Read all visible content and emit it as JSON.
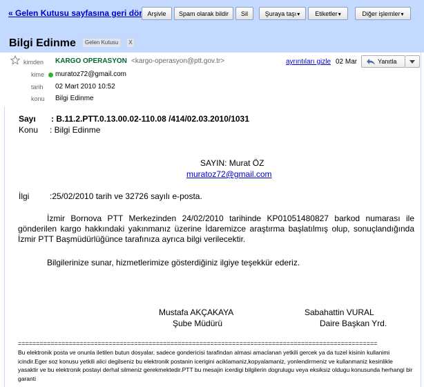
{
  "toolbar": {
    "back_link": "« Gelen Kutusu sayfasına geri dön",
    "archive": "Arşivle",
    "spam": "Spam olarak bildir",
    "delete": "Sil",
    "move_to": "Şuraya taşı",
    "labels": "Etiketler",
    "more_actions": "Diğer işlemler",
    "caret": "▾"
  },
  "message": {
    "subject": "Bilgi Edinme",
    "label_chip": "Gelen Kutusu",
    "label_remove": "X",
    "from_label": "kimden",
    "from_name": "KARGO OPERASYON",
    "from_email": "<kargo-operasyon@ptt.gov.tr>",
    "details_link": "ayrıntıları gizle",
    "date_short": "02 Mar",
    "reply": "Yanıtla",
    "to_label": "kime",
    "to_value": "muratoz72@gmail.com",
    "date_label": "tarih",
    "date_value": "02 Mart 2010 10:52",
    "subject_label": "konu",
    "subject_value": "Bilgi Edinme"
  },
  "body": {
    "sayi_label": "Sayı",
    "sayi_value": ": B.11.2.PTT.0.13.00.02-110.08 /414/02.03.2010/1031",
    "konu_label": "Konu",
    "konu_value": ": Bilgi Edinme",
    "salutation": "SAYIN: Murat ÖZ",
    "email_link": "muratoz72@gmail.com",
    "ilgi_label": "İlgi",
    "ilgi_value": ":25/02/2010 tarih ve 32726 sayılı e-posta.",
    "paragraph1": "İzmir Bornova PTT Merkezinden 24/02/2010 tarihinde KP01051480827 barkod numarası ile gönderilen kargo hakkındaki yakınmanız üzerine İdaremizce araştırma başlatılmış olup, sonuçlandığında İzmir PTT Başmüdürlüğünce tarafınıza ayrıca bilgi verilecektir.",
    "paragraph2": "Bilgilerinize sunar, hizmetlerimize gösterdiğiniz ilgiye teşekkür ederiz.",
    "sig1_name": "Mustafa AKÇAKAYA",
    "sig1_title": "Şube Müdürü",
    "sig2_name": "Sabahattin VURAL",
    "sig2_title": "Daire Başkan Yrd.",
    "rule": "===================================================================================================",
    "disclaimer": "Bu elektronik posta ve onunla iletilen butun dosyalar, sadece gondericisi tarafindan almasi amaclanan yetkili gercek ya da tuzel kisinin kullanimi icindir.Eger soz konusu yetkili alici degilseniz bu elektronik postanin icerigini aciklamaniz,kopyalamaniz, yonlendirmeniz ve kullanmaniz kesinlikle yasaktir ve bu elektronik postayi derhal silmeniz gerekmektedir.PTT bu mesajin icerdigi bilgilerin dogrulugu veya eksiksiz oldugu konusunda herhangi bir garanti"
  },
  "colors": {
    "toolbar_bg": "#c3d9ff",
    "link": "#0000cc",
    "sender": "#006633",
    "online": "#2fb32f"
  }
}
